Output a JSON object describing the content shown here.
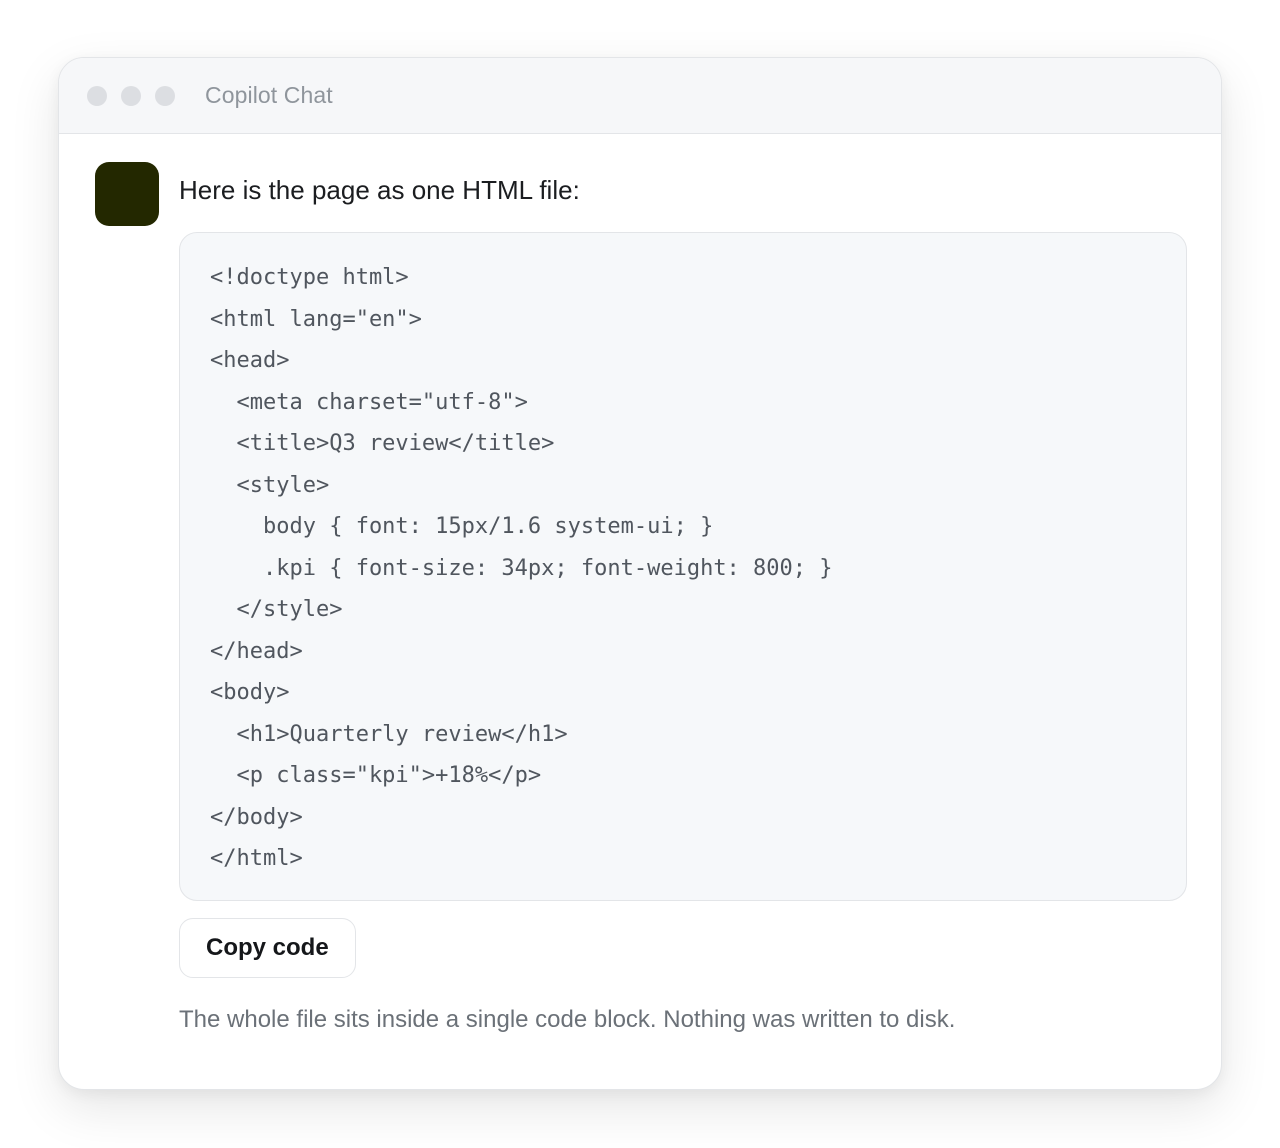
{
  "window": {
    "title": "Copilot Chat"
  },
  "message": {
    "intro": "Here is the page as one HTML file:",
    "code_lines": [
      "<!doctype html>",
      "<html lang=\"en\">",
      "<head>",
      "  <meta charset=\"utf-8\">",
      "  <title>Q3 review</title>",
      "  <style>",
      "    body { font: 15px/1.6 system-ui; }",
      "    .kpi { font-size: 34px; font-weight: 800; }",
      "  </style>",
      "</head>",
      "<body>",
      "  <h1>Quarterly review</h1>",
      "  <p class=\"kpi\">+18%</p>",
      "</body>",
      "</html>"
    ],
    "copy_label": "Copy code",
    "note": "The whole file sits inside a single code block. Nothing was written to disk."
  },
  "colors": {
    "avatar": "#232800",
    "code_background": "#f6f8fa",
    "titlebar": "#f6f7f9"
  }
}
